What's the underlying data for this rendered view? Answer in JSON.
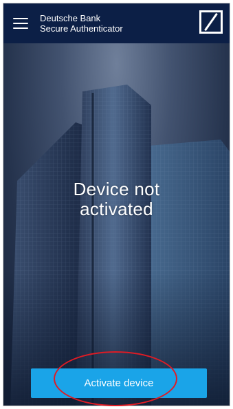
{
  "app_bar": {
    "title_line1": "Deutsche Bank",
    "title_line2": "Secure Authenticator",
    "menu_icon": "hamburger-menu-icon",
    "logo": "deutsche-bank-logo"
  },
  "main": {
    "status_line1": "Device not",
    "status_line2": "activated",
    "activate_label": "Activate device"
  },
  "colors": {
    "app_bar": "#0c1f46",
    "button": "#1aa4e8",
    "annotation": "#e01b24"
  }
}
